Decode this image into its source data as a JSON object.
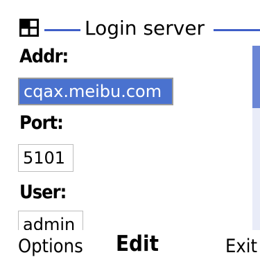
{
  "title_bar": {
    "title": "Login server",
    "icon": "app-window-icon",
    "accent_color": "#3f5ec8"
  },
  "form": {
    "fields": [
      {
        "label": "Addr:",
        "value": "cqax.meibu.com",
        "selected": true
      },
      {
        "label": "Port:",
        "value": "5101",
        "selected": false
      },
      {
        "label": "User:",
        "value": "admin",
        "selected": false
      }
    ]
  },
  "scrollbar": {
    "thumb_fraction": 0.34,
    "position_fraction": 0.0
  },
  "softkeys": {
    "left": "Options",
    "center": "Edit",
    "right": "Exit"
  }
}
